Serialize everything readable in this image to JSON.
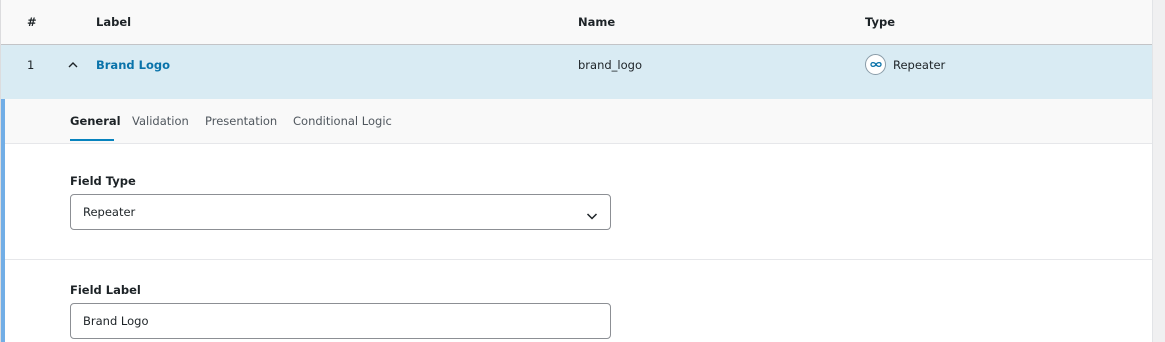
{
  "table_header": {
    "num": "#",
    "label": "Label",
    "name": "Name",
    "type": "Type"
  },
  "field": {
    "order": "1",
    "label": "Brand Logo",
    "name": "brand_logo",
    "type": "Repeater",
    "type_icon": "infinity-icon"
  },
  "tabs": [
    "General",
    "Validation",
    "Presentation",
    "Conditional Logic"
  ],
  "active_tab": "General",
  "settings": {
    "field_type": {
      "label": "Field Type",
      "value": "Repeater"
    },
    "field_label": {
      "label": "Field Label",
      "value": "Brand Logo"
    }
  },
  "colors": {
    "accent": "#0783be",
    "link": "#0a73aa",
    "row_highlight": "#d9ebf3",
    "settings_border": "#72aee6"
  }
}
